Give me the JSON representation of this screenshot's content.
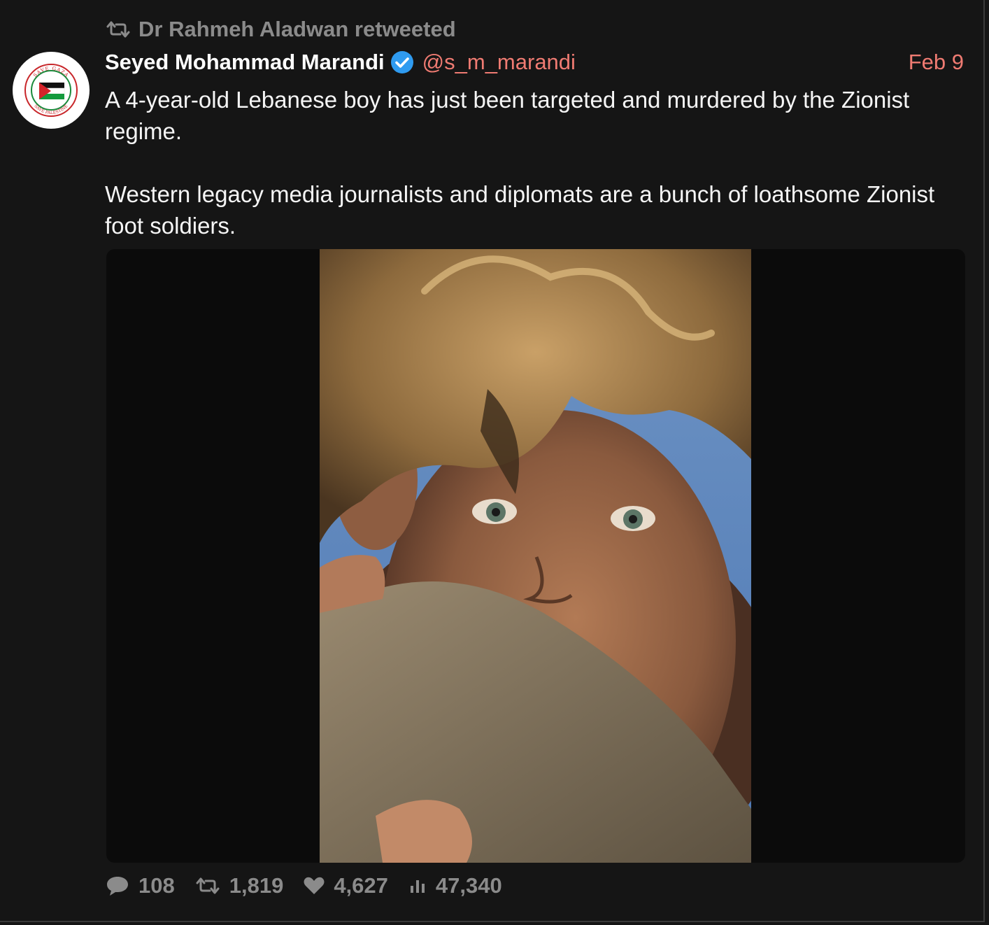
{
  "retweet": {
    "text": "Dr Rahmeh Aladwan retweeted"
  },
  "author": {
    "name": "Seyed Mohammad Marandi",
    "handle": "@s_m_marandi",
    "verified": true,
    "avatar_text_top": "SAVE GAZA",
    "avatar_text_bottom": "SAVE PALESTINE"
  },
  "date": "Feb 9",
  "body": [
    "A 4-year-old Lebanese boy has just been targeted and murdered by the Zionist regime.",
    "Western legacy media journalists and diplomats are a bunch of loathsome Zionist foot soldiers."
  ],
  "stats": {
    "replies": "108",
    "retweets": "1,819",
    "likes": "4,627",
    "views": "47,340"
  },
  "colors": {
    "background": "#151515",
    "accent": "#ef7b72",
    "muted": "#8b8b8b",
    "verified": "#2f9bf0"
  },
  "icons": [
    "retweet-icon",
    "verified-badge-icon",
    "reply-icon",
    "retweet-icon",
    "heart-icon",
    "views-icon"
  ]
}
